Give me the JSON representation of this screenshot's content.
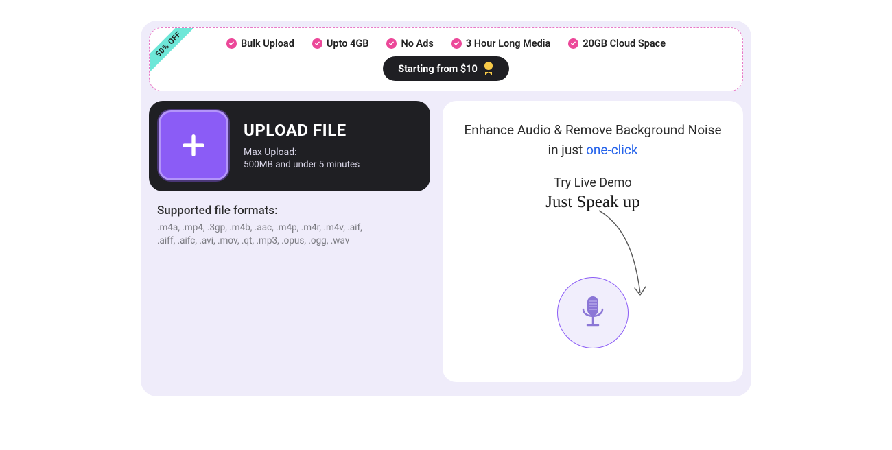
{
  "promo": {
    "discount": "50% OFF",
    "features": [
      "Bulk Upload",
      "Upto 4GB",
      "No Ads",
      "3 Hour Long Media",
      "20GB Cloud Space"
    ],
    "price": "Starting from $10"
  },
  "upload": {
    "title": "UPLOAD FILE",
    "sub1": "Max Upload:",
    "sub2": "500MB and under 5 minutes"
  },
  "formats": {
    "title": "Supported file formats:",
    "list": ".m4a, .mp4, .3gp, .m4b, .aac, .m4p, .m4r, .m4v, .aif, .aiff, .aifc, .avi, .mov, .qt, .mp3, .opus, .ogg, .wav"
  },
  "demo": {
    "line1": "Enhance Audio & Remove Background Noise in just ",
    "link": "one-click",
    "try": "Try Live Demo",
    "speak": "Just Speak up"
  }
}
